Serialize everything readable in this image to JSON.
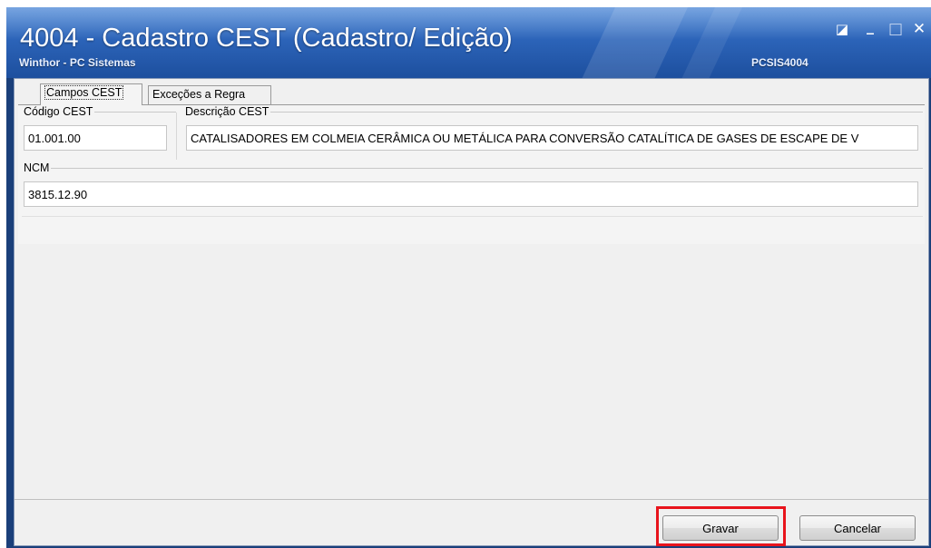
{
  "window": {
    "title": "4004 - Cadastro CEST (Cadastro/ Edição)",
    "subtitle": "Winthor - PC Sistemas",
    "routine_code": "PCSIS4004",
    "controls": {
      "restore": "◪",
      "minimize": "_",
      "maximize": "□",
      "close": "✕"
    }
  },
  "tabs": [
    {
      "label": "Campos CEST",
      "active": true
    },
    {
      "label": "Exceções a Regra",
      "active": false
    }
  ],
  "fields": {
    "codigo_cest": {
      "label": "Código CEST",
      "value": "01.001.00"
    },
    "descricao_cest": {
      "label": "Descrição CEST",
      "value": "CATALISADORES EM COLMEIA CERÂMICA OU METÁLICA PARA CONVERSÃO CATALÍTICA DE GASES DE ESCAPE DE V"
    },
    "ncm": {
      "label": "NCM",
      "value": "3815.12.90"
    }
  },
  "buttons": {
    "save": "Gravar",
    "cancel": "Cancelar"
  },
  "colors": {
    "titlebar": "#2c64b9",
    "highlight": "#e8141c",
    "client_bg": "#f0f0f0"
  }
}
